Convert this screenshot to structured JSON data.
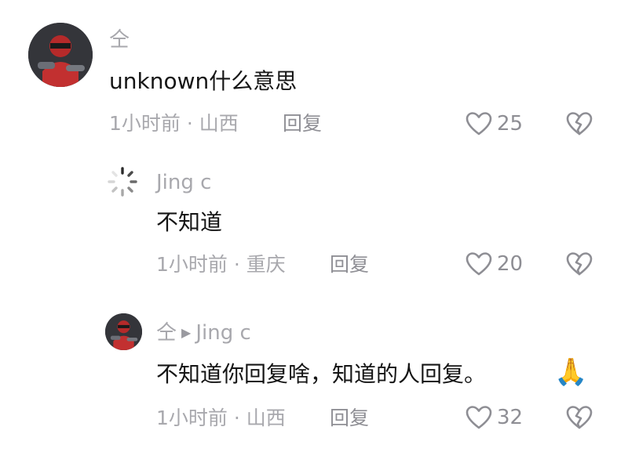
{
  "comments": [
    {
      "username": "仝",
      "text": "unknown什么意思",
      "time": "1小时前",
      "location": "山西",
      "meta_sep": " · ",
      "reply_label": "回复",
      "likes": "25"
    },
    {
      "username": "Jing c",
      "text": "不知道",
      "time": "1小时前",
      "location": "重庆",
      "meta_sep": " · ",
      "reply_label": "回复",
      "likes": "20"
    },
    {
      "username": "仝",
      "reply_to": "Jing c",
      "text": "不知道你回复啥，知道的人回复。",
      "emoji": "🙏",
      "time": "1小时前",
      "location": "山西",
      "meta_sep": " · ",
      "reply_label": "回复",
      "likes": "32"
    }
  ],
  "icons": {
    "like": "heart-outline-icon",
    "dislike": "broken-heart-icon",
    "reply_arrow": "triangle-right-icon"
  },
  "colors": {
    "text": "#151515",
    "muted": "#a8a8ad",
    "icon": "#8e8e94"
  }
}
